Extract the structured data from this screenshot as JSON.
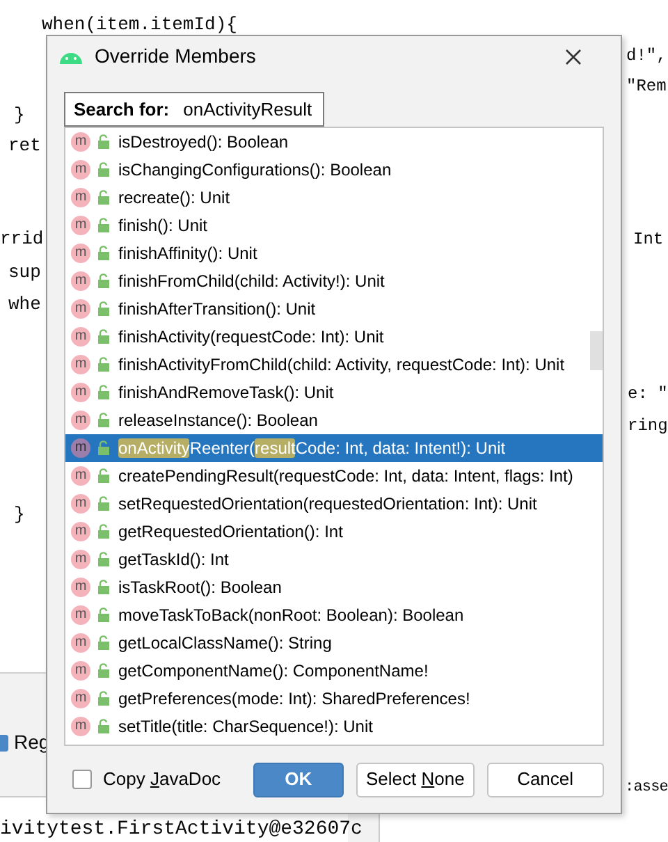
{
  "editor": {
    "lines": [
      {
        "text": "when(item.itemId){"
      },
      {
        "text": "d!\","
      },
      {
        "text": "\"Rem"
      },
      {
        "text": "}"
      },
      {
        "text": "ret"
      },
      {
        "text": "rrid"
      },
      {
        "text": "Int"
      },
      {
        "text": "sup"
      },
      {
        "text": "whe"
      },
      {
        "text": "e: \""
      },
      {
        "text": "ring"
      },
      {
        "text": "}"
      }
    ],
    "run_panel": {
      "checkbox_label": "Reg",
      "checked": true,
      "log": "ivitytest.FirstActivity@e32607c",
      "side_text": ":asse"
    }
  },
  "dialog": {
    "title": "Override Members",
    "search": {
      "label": "Search for:",
      "value": "onActivityResult"
    },
    "members": [
      {
        "icon": "m",
        "parts": [
          {
            "text": "isDestroyed(): Boolean",
            "match": false
          }
        ],
        "selected": false
      },
      {
        "icon": "m",
        "parts": [
          {
            "text": "isChangingConfigurations(): Boolean",
            "match": false
          }
        ],
        "selected": false
      },
      {
        "icon": "m",
        "parts": [
          {
            "text": "recreate(): Unit",
            "match": false
          }
        ],
        "selected": false
      },
      {
        "icon": "m",
        "parts": [
          {
            "text": "finish(): Unit",
            "match": false
          }
        ],
        "selected": false
      },
      {
        "icon": "m",
        "parts": [
          {
            "text": "finishAffinity(): Unit",
            "match": false
          }
        ],
        "selected": false
      },
      {
        "icon": "m",
        "parts": [
          {
            "text": "finishFromChild(child: Activity!): Unit",
            "match": false
          }
        ],
        "selected": false
      },
      {
        "icon": "m",
        "parts": [
          {
            "text": "finishAfterTransition(): Unit",
            "match": false
          }
        ],
        "selected": false
      },
      {
        "icon": "m",
        "parts": [
          {
            "text": "finishActivity(requestCode: Int): Unit",
            "match": false
          }
        ],
        "selected": false
      },
      {
        "icon": "m",
        "parts": [
          {
            "text": "finishActivityFromChild(child: Activity, requestCode: Int): Unit",
            "match": false
          }
        ],
        "selected": false
      },
      {
        "icon": "m",
        "parts": [
          {
            "text": "finishAndRemoveTask(): Unit",
            "match": false
          }
        ],
        "selected": false
      },
      {
        "icon": "m",
        "parts": [
          {
            "text": "releaseInstance(): Boolean",
            "match": false
          }
        ],
        "selected": false
      },
      {
        "icon": "m",
        "parts": [
          {
            "text": "onActivity",
            "match": true
          },
          {
            "text": "Reenter(",
            "match": false
          },
          {
            "text": "result",
            "match": true
          },
          {
            "text": "Code: Int, data: Intent!): Unit",
            "match": false
          }
        ],
        "selected": true
      },
      {
        "icon": "m",
        "parts": [
          {
            "text": "createPendingResult(requestCode: Int, data: Intent, flags: Int)",
            "match": false
          }
        ],
        "selected": false
      },
      {
        "icon": "m",
        "parts": [
          {
            "text": "setRequestedOrientation(requestedOrientation: Int): Unit",
            "match": false
          }
        ],
        "selected": false
      },
      {
        "icon": "m",
        "parts": [
          {
            "text": "getRequestedOrientation(): Int",
            "match": false
          }
        ],
        "selected": false
      },
      {
        "icon": "m",
        "parts": [
          {
            "text": "getTaskId(): Int",
            "match": false
          }
        ],
        "selected": false
      },
      {
        "icon": "m",
        "parts": [
          {
            "text": "isTaskRoot(): Boolean",
            "match": false
          }
        ],
        "selected": false
      },
      {
        "icon": "m",
        "parts": [
          {
            "text": "moveTaskToBack(nonRoot: Boolean): Boolean",
            "match": false
          }
        ],
        "selected": false
      },
      {
        "icon": "m",
        "parts": [
          {
            "text": "getLocalClassName(): String",
            "match": false
          }
        ],
        "selected": false
      },
      {
        "icon": "m",
        "parts": [
          {
            "text": "getComponentName(): ComponentName!",
            "match": false
          }
        ],
        "selected": false
      },
      {
        "icon": "m",
        "parts": [
          {
            "text": "getPreferences(mode: Int): SharedPreferences!",
            "match": false
          }
        ],
        "selected": false
      },
      {
        "icon": "m",
        "parts": [
          {
            "text": "setTitle(title: CharSequence!): Unit",
            "match": false
          }
        ],
        "selected": false
      }
    ],
    "copy_javadoc": {
      "label_parts": [
        "Copy ",
        "J",
        "avaDoc"
      ],
      "checked": false
    },
    "buttons": [
      {
        "kind": "primary",
        "label_parts": [
          "OK"
        ]
      },
      {
        "kind": "secondary",
        "label_parts": [
          "Select ",
          "N",
          "one"
        ]
      },
      {
        "kind": "secondary",
        "label_parts": [
          "Cancel"
        ]
      }
    ]
  }
}
